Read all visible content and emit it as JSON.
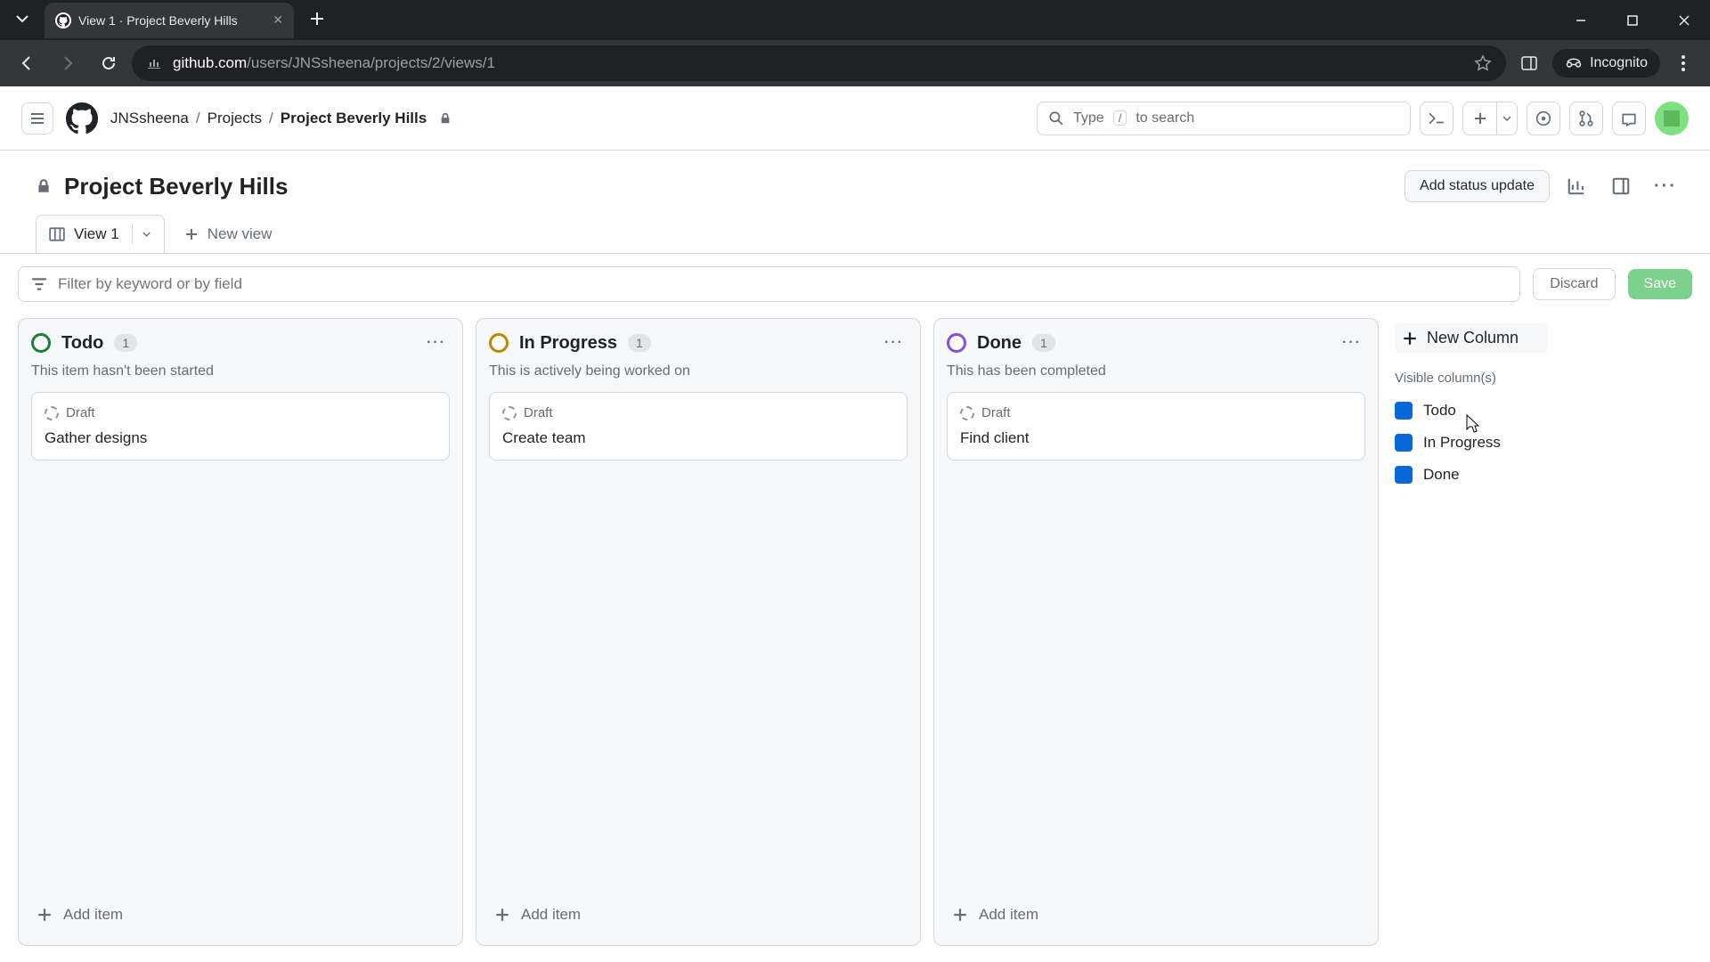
{
  "browser": {
    "tab_title": "View 1 · Project Beverly Hills",
    "url_domain": "github.com",
    "url_path": "/users/JNSsheena/projects/2/views/1",
    "incognito_label": "Incognito"
  },
  "header": {
    "breadcrumbs": {
      "owner": "JNSsheena",
      "section": "Projects",
      "project": "Project Beverly Hills"
    },
    "search_placeholder_pre": "Type",
    "search_kbd": "/",
    "search_placeholder_post": "to search"
  },
  "project": {
    "title": "Project Beverly Hills",
    "add_status_label": "Add status update"
  },
  "views": {
    "current": "View 1",
    "new_view_label": "New view"
  },
  "filter": {
    "placeholder": "Filter by keyword or by field",
    "discard_label": "Discard",
    "save_label": "Save"
  },
  "board": {
    "columns": [
      {
        "name": "Todo",
        "count": "1",
        "status_class": "status-todo",
        "description": "This item hasn't been started",
        "cards": [
          {
            "draft_label": "Draft",
            "title": "Gather designs"
          }
        ]
      },
      {
        "name": "In Progress",
        "count": "1",
        "status_class": "status-inprogress",
        "description": "This is actively being worked on",
        "cards": [
          {
            "draft_label": "Draft",
            "title": "Create team"
          }
        ]
      },
      {
        "name": "Done",
        "count": "1",
        "status_class": "status-done",
        "description": "This has been completed",
        "cards": [
          {
            "draft_label": "Draft",
            "title": "Find client"
          }
        ]
      }
    ],
    "add_item_label": "Add item",
    "new_column_label": "New Column",
    "visible_columns_label": "Visible column(s)",
    "visible_columns": [
      "Todo",
      "In Progress",
      "Done"
    ]
  }
}
